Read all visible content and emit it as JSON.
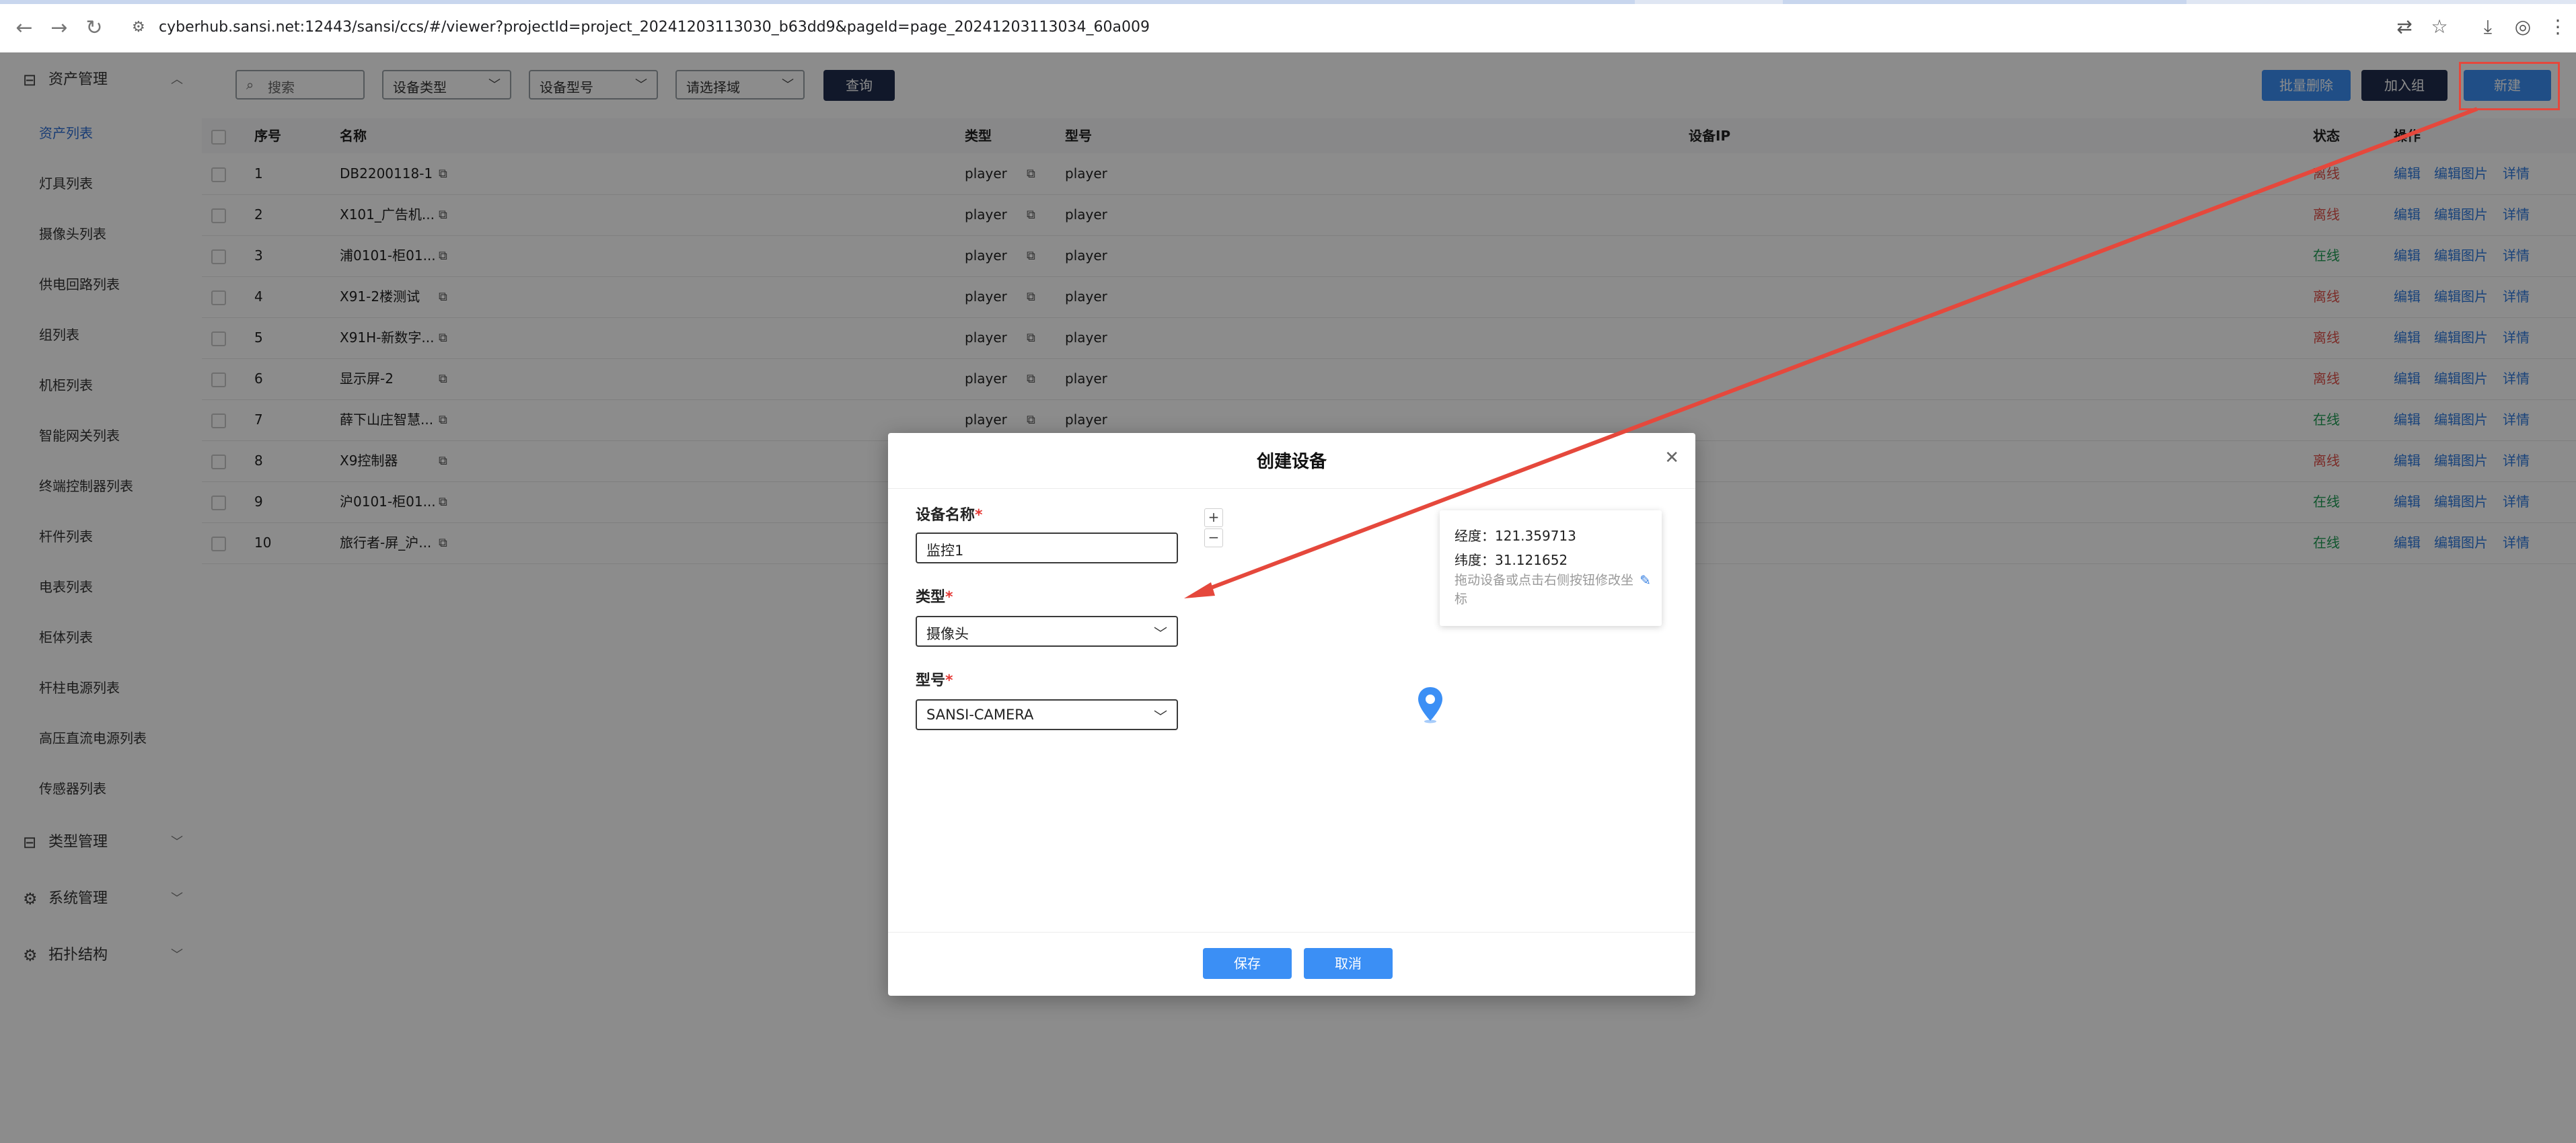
{
  "browser": {
    "url": "cyberhub.sansi.net:12443/sansi/ccs/#/viewer?projectId=project_20241203113030_b63dd9&pageId=page_20241203113034_60a009"
  },
  "sidebar": {
    "groups": [
      {
        "label": "资产管理"
      },
      {
        "label": "类型管理"
      },
      {
        "label": "系统管理"
      },
      {
        "label": "拓扑结构"
      }
    ],
    "items": [
      {
        "label": "资产列表"
      },
      {
        "label": "灯具列表"
      },
      {
        "label": "摄像头列表"
      },
      {
        "label": "供电回路列表"
      },
      {
        "label": "组列表"
      },
      {
        "label": "机柜列表"
      },
      {
        "label": "智能网关列表"
      },
      {
        "label": "终端控制器列表"
      },
      {
        "label": "杆件列表"
      },
      {
        "label": "电表列表"
      },
      {
        "label": "柜体列表"
      },
      {
        "label": "杆柱电源列表"
      },
      {
        "label": "高压直流电源列表"
      },
      {
        "label": "传感器列表"
      }
    ]
  },
  "toolbar": {
    "search_placeholder": "搜索",
    "device_type": "设备类型",
    "device_model": "设备型号",
    "region": "请选择域",
    "query_label": "查询",
    "batch_delete_label": "批量删除",
    "join_group_label": "加入组",
    "new_label": "新建"
  },
  "table": {
    "headers": {
      "seq": "序号",
      "name": "名称",
      "type": "类型",
      "model": "型号",
      "ip": "设备IP",
      "status": "状态",
      "actions": "操作"
    },
    "rows": [
      {
        "seq": "1",
        "name": "DB2200118-1",
        "type": "player",
        "model": "player",
        "status": "离线"
      },
      {
        "seq": "2",
        "name": "X101_广告机...",
        "type": "player",
        "model": "player",
        "status": "离线"
      },
      {
        "seq": "3",
        "name": "浦0101-柜01...",
        "type": "player",
        "model": "player",
        "status": "在线"
      },
      {
        "seq": "4",
        "name": "X91-2楼测试",
        "type": "player",
        "model": "player",
        "status": "离线"
      },
      {
        "seq": "5",
        "name": "X91H-新数字...",
        "type": "player",
        "model": "player",
        "status": "离线"
      },
      {
        "seq": "6",
        "name": "显示屏-2",
        "type": "player",
        "model": "player",
        "status": "离线"
      },
      {
        "seq": "7",
        "name": "薛下山庄智慧...",
        "type": "player",
        "model": "player",
        "status": "在线"
      },
      {
        "seq": "8",
        "name": "X9控制器",
        "type": "player",
        "model": "player",
        "status": "离线"
      },
      {
        "seq": "9",
        "name": "沪0101-柜01...",
        "type": "player",
        "model": "player",
        "status": "在线"
      },
      {
        "seq": "10",
        "name": "旅行者-屏_沪...",
        "type": "player",
        "model": "player",
        "status": "在线"
      }
    ],
    "actions": {
      "edit": "编辑",
      "edit_image": "编辑图片",
      "detail": "详情"
    }
  },
  "modal": {
    "title": "创建设备",
    "name_label": "设备名称",
    "name_value": "监控1",
    "type_label": "类型",
    "type_value": "摄像头",
    "model_label": "型号",
    "model_value": "SANSI-CAMERA",
    "required_mark": "*",
    "zoom_in": "+",
    "zoom_out": "−",
    "longitude": "经度：121.359713",
    "latitude": "纬度：31.121652",
    "hint": "拖动设备或点击右侧按钮修改坐标",
    "save_label": "保存",
    "cancel_label": "取消"
  },
  "colors": {
    "primary_dark": "#1f2d4d",
    "primary_blue": "#3b8ff5",
    "offline": "#e0504a",
    "online": "#1f9d55",
    "annotation": "#e5483c"
  }
}
